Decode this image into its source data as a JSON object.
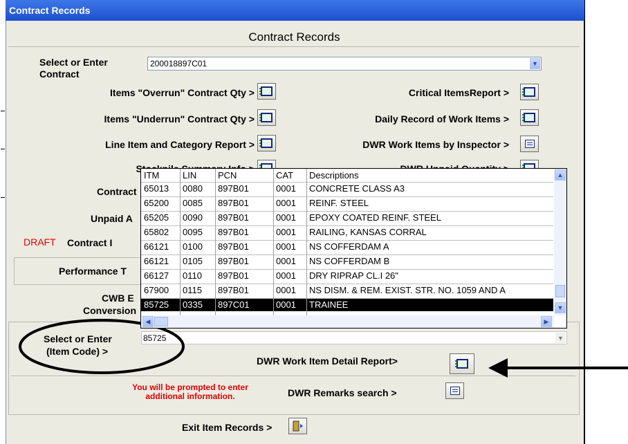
{
  "window": {
    "title": "Contract Records"
  },
  "header": {
    "title": "Contract Records"
  },
  "contract": {
    "label": "Select or Enter Contract",
    "value": "200018897C01"
  },
  "reports_left": [
    {
      "label": "Items \"Overrun\" Contract Qty >"
    },
    {
      "label": "Items \"Underrun\" Contract Qty >"
    },
    {
      "label": "Line Item and Category Report >"
    },
    {
      "label": "Stockpile Summary Info >"
    }
  ],
  "reports_right": [
    {
      "label": "Critical ItemsReport >"
    },
    {
      "label": "Daily Record of Work Items >"
    },
    {
      "label": "DWR Work Items by Inspector >"
    },
    {
      "label": "DWR Unpaid Quantity >"
    }
  ],
  "partial_labels": {
    "contract": "Contract",
    "unpaid": "Unpaid A",
    "draft": "DRAFT",
    "contract2": "Contract I",
    "performance": "Performance T",
    "cwb": "CWB E",
    "conversion": "Conversion"
  },
  "grid": {
    "columns": [
      "ITM",
      "LIN",
      "PCN",
      "CAT",
      "Descriptions"
    ],
    "rows": [
      [
        "65013",
        "0080",
        "897B01",
        "0001",
        "CONCRETE CLASS A3"
      ],
      [
        "65200",
        "0085",
        "897B01",
        "0001",
        "REINF. STEEL"
      ],
      [
        "65205",
        "0090",
        "897B01",
        "0001",
        "EPOXY COATED REINF. STEEL"
      ],
      [
        "65802",
        "0095",
        "897B01",
        "0001",
        "RAILING, KANSAS CORRAL"
      ],
      [
        "66121",
        "0100",
        "897B01",
        "0001",
        "NS COFFERDAM A"
      ],
      [
        "66121",
        "0105",
        "897B01",
        "0001",
        "NS COFFERDAM B"
      ],
      [
        "66127",
        "0110",
        "897B01",
        "0001",
        "DRY RIPRAP CL.I 26\""
      ],
      [
        "67900",
        "0115",
        "897B01",
        "0001",
        "NS DISM. & REM. EXIST. STR. NO. 1059 AND A"
      ],
      [
        "85725",
        "0335",
        "897C01",
        "0001",
        "TRAINEE"
      ]
    ],
    "selected_row": 8
  },
  "item": {
    "label_line1": "Select or Enter",
    "label_line2": "(Item Code) >",
    "value": "85725"
  },
  "detail_report": {
    "label": "DWR Work Item Detail Report>"
  },
  "prompt_note": {
    "line1": "You will be prompted to enter",
    "line2": "additional information."
  },
  "remarks": {
    "label": "DWR Remarks search >"
  },
  "exit": {
    "label": "Exit Item Records >"
  },
  "icons": {
    "report": "report-icon",
    "form": "form-icon",
    "exit": "exit-door-icon",
    "arrow": "arrow-left-icon"
  },
  "colors": {
    "titlebar": "#1d4fcf",
    "draft": "#e00000",
    "note": "#e00000",
    "selected_row": "#000000"
  }
}
